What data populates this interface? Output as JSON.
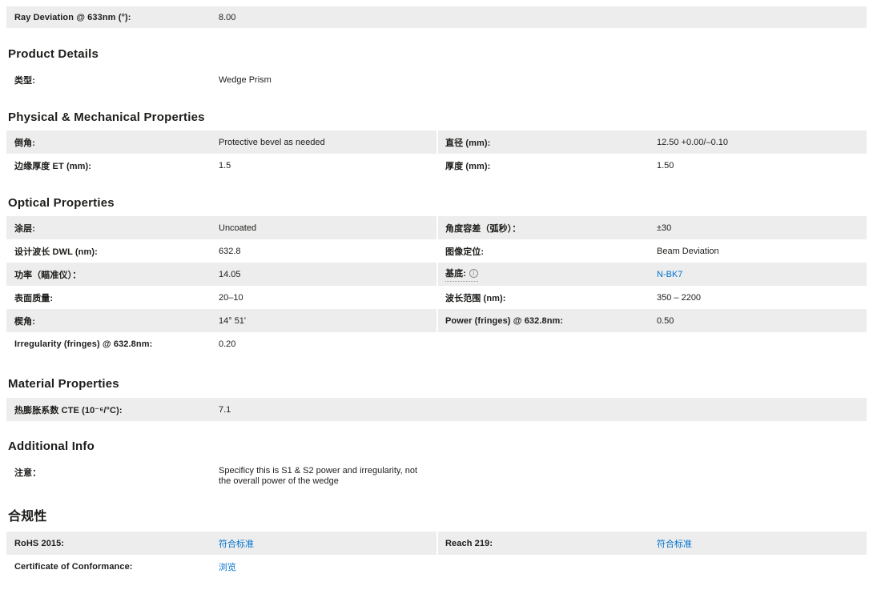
{
  "colors": {
    "text": "#1d1d1b",
    "row_gray": "#ededed",
    "link_blue": "#0072ce",
    "icon_gray": "#8a8a8a"
  },
  "spec": {
    "ray_deviation": {
      "label": "Ray Deviation @ 633nm (°):",
      "value": "8.00"
    },
    "product_details": {
      "heading": "Product Details",
      "type": {
        "label": "类型:",
        "value": "Wedge Prism"
      }
    },
    "physical": {
      "heading": "Physical & Mechanical Properties",
      "bevel": {
        "label": "倒角:",
        "value": "Protective bevel as needed"
      },
      "diameter": {
        "label": "直径 (mm):",
        "value": "12.50 +0.00/–0.10"
      },
      "edge_thickness": {
        "label": "边缘厚度 ET (mm):",
        "value": "1.5"
      },
      "thickness": {
        "label": "厚度 (mm):",
        "value": "1.50"
      }
    },
    "optical": {
      "heading": "Optical Properties",
      "coating": {
        "label": "涂层:",
        "value": "Uncoated"
      },
      "angle_tolerance": {
        "label": "角度容差（弧秒）：",
        "value": "±30"
      },
      "design_wavelength": {
        "label": "设计波长 DWL (nm):",
        "value": "632.8"
      },
      "image_orientation": {
        "label": "图像定位:",
        "value": "Beam Deviation"
      },
      "power_collimator": {
        "label": "功率（瞄准仪）：",
        "value": "14.05"
      },
      "substrate": {
        "label": "基底:",
        "info_icon": "i",
        "value": "N-BK7"
      },
      "surface_quality": {
        "label": "表面质量:",
        "value": "20–10"
      },
      "wavelength_range": {
        "label": "波长范围 (nm):",
        "value": "350 – 2200"
      },
      "wedge_angle": {
        "label": "楔角:",
        "value": "14° 51'"
      },
      "power_fringes": {
        "label": "Power (fringes) @ 632.8nm:",
        "value": "0.50"
      },
      "irregularity": {
        "label": "Irregularity (fringes) @ 632.8nm:",
        "value": "0.20"
      }
    },
    "material": {
      "heading": "Material Properties",
      "cte": {
        "label": "热膨胀系数 CTE (10⁻⁶/°C):",
        "value": "7.1"
      }
    },
    "additional": {
      "heading": "Additional Info",
      "note": {
        "label": "注意：",
        "value": "Specificy this is S1 & S2 power and irregularity, not the overall power of the wedge"
      }
    },
    "compliance": {
      "heading": "合规性",
      "rohs": {
        "label": "RoHS 2015:",
        "value": "符合标准"
      },
      "reach": {
        "label": "Reach 219:",
        "value": "符合标准"
      },
      "certificate": {
        "label": "Certificate of Conformance:",
        "value": "浏览"
      }
    }
  }
}
